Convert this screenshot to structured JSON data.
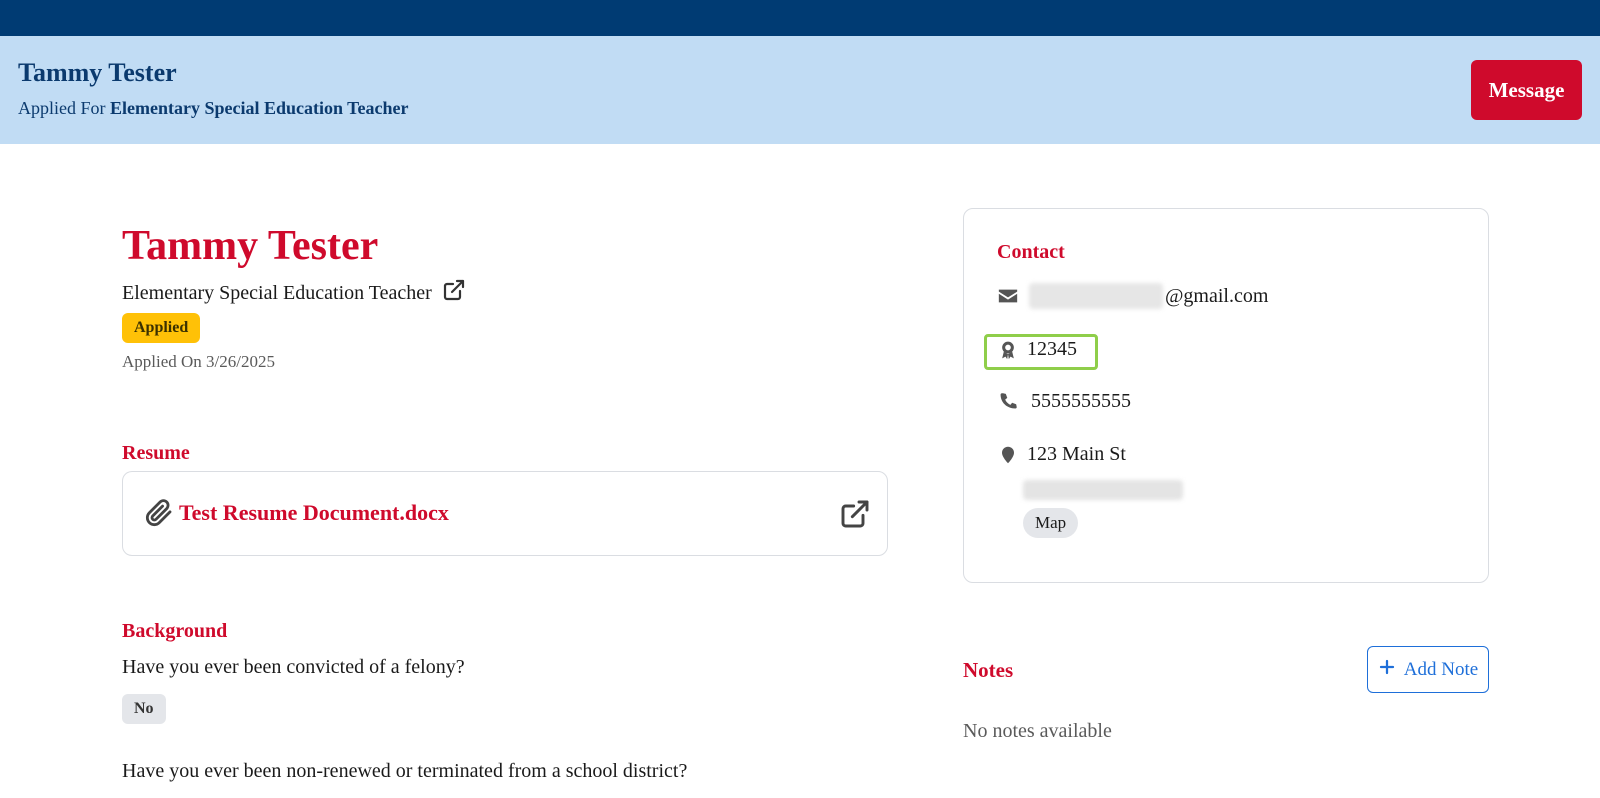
{
  "header": {
    "name": "Tammy Tester",
    "applied_prefix": "Applied For ",
    "applied_job": "Elementary Special Education Teacher",
    "message_label": "Message"
  },
  "profile": {
    "name": "Tammy Tester",
    "job_title": "Elementary Special Education Teacher",
    "status_badge": "Applied",
    "applied_on": "Applied On 3/26/2025"
  },
  "resume": {
    "section_title": "Resume",
    "file_name": "Test Resume Document.docx"
  },
  "background": {
    "section_title": "Background",
    "questions": [
      {
        "question": "Have you ever been convicted of a felony?",
        "answer": "No"
      },
      {
        "question": "Have you ever been non-renewed or terminated from a school district?"
      }
    ]
  },
  "contact": {
    "title": "Contact",
    "email_domain": "@gmail.com",
    "certificate_id": "12345",
    "phone": "5555555555",
    "address_line1": "123 Main St",
    "map_label": "Map"
  },
  "notes": {
    "title": "Notes",
    "add_label": "Add Note",
    "empty_text": "No notes available"
  },
  "colors": {
    "topbar": "#003b73",
    "header_bg": "#c1dcf4",
    "accent_red": "#cf0a2c",
    "badge_yellow": "#ffc107",
    "link_blue": "#1e6fd9",
    "highlight_green": "#8fce4a"
  }
}
